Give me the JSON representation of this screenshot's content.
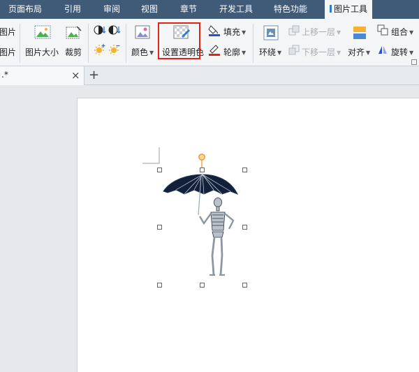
{
  "menu": {
    "tabs": [
      {
        "label": "页面布局"
      },
      {
        "label": "引用"
      },
      {
        "label": "审阅"
      },
      {
        "label": "视图"
      },
      {
        "label": "章节"
      },
      {
        "label": "开发工具"
      },
      {
        "label": "特色功能"
      },
      {
        "label": "图片工具"
      }
    ]
  },
  "ribbon": {
    "left_cut_top": "图片",
    "left_cut_bottom": "图片",
    "picture_size": "图片大小",
    "crop": "裁剪",
    "color": "颜色",
    "set_transparent_color": "设置透明色",
    "fill": "填充",
    "outline": "轮廓",
    "wrap": "环绕",
    "bring_forward": "上移一层",
    "send_backward": "下移一层",
    "align": "对齐",
    "group": "组合",
    "rotate": "旋转"
  },
  "doc": {
    "tab_title": ".*",
    "close_glyph": "×",
    "new_tab_glyph": "+"
  },
  "colors": {
    "menubar": "#3f5b78",
    "highlight_box": "#e2231a",
    "accent": "#2b7bd0"
  }
}
